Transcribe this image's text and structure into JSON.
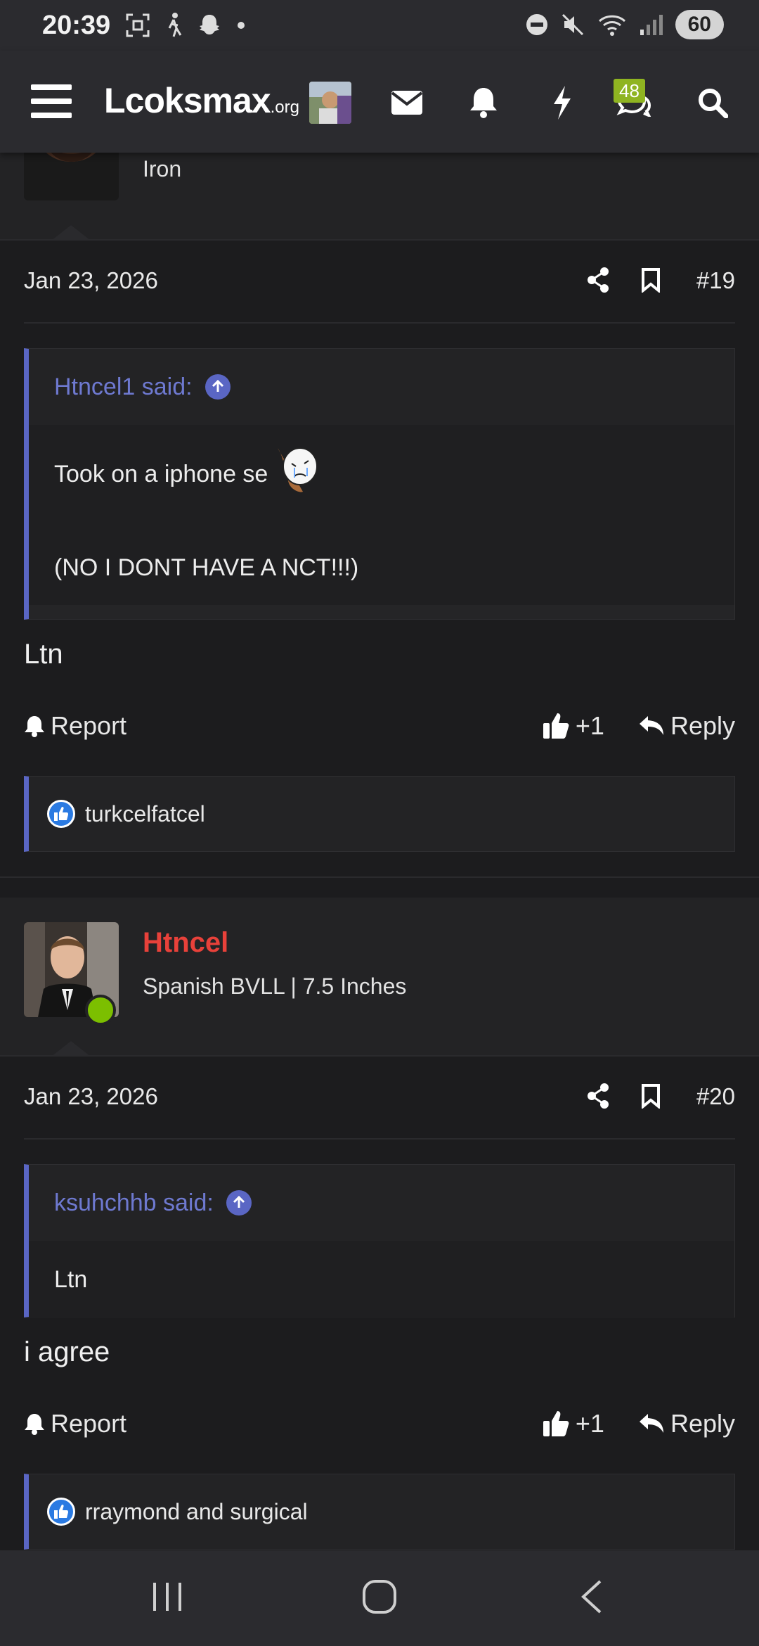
{
  "status": {
    "time": "20:39",
    "battery": "60"
  },
  "nav": {
    "logo_main": "Lcoksmax",
    "logo_suffix": ".org",
    "badge_count": "48"
  },
  "post19": {
    "prev_rank": "Iron",
    "date": "Jan 23, 2026",
    "number": "#19",
    "quote_author": "Htncel1 said:",
    "quote_line1": "Took on a iphone se",
    "quote_line2": "(NO I DONT HAVE A NCT!!!)",
    "text": "Ltn",
    "report": "Report",
    "like_count": "+1",
    "reply": "Reply",
    "likers": "turkcelfatcel"
  },
  "post20": {
    "username": "Htncel",
    "rank": "Spanish BVLL | 7.5 Inches",
    "date": "Jan 23, 2026",
    "number": "#20",
    "quote_author": "ksuhchhb said:",
    "quote_line1": "Ltn",
    "text": "i agree",
    "report": "Report",
    "like_count": "+1",
    "reply": "Reply",
    "likers": "rraymond and surgical"
  },
  "colors": {
    "accent": "#5a66c4",
    "username_red": "#e8413a",
    "online_green": "#7cbf00",
    "badge_green": "#8fb421"
  }
}
